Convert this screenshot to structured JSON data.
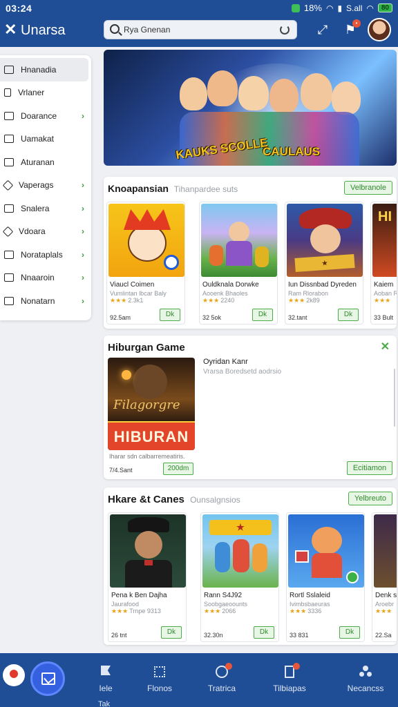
{
  "status_bar": {
    "time": "03:24",
    "indicators": "18%",
    "signal": "S.all",
    "battery_label": "80"
  },
  "app": {
    "title": "Unarsa",
    "search_value": "Rya Gnenan"
  },
  "sidebar": {
    "items": [
      {
        "label": "Hnanadia",
        "icon": "home-icon",
        "chevron": false,
        "active": true
      },
      {
        "label": "Vrlaner",
        "icon": "bookmark-icon",
        "chevron": false
      },
      {
        "label": "Doarance",
        "icon": "bag-icon",
        "chevron": true
      },
      {
        "label": "Uamakat",
        "icon": "cart-icon",
        "chevron": false
      },
      {
        "label": "Aturanan",
        "icon": "lock-icon",
        "chevron": false
      },
      {
        "label": "Vaperags",
        "icon": "puzzle-icon",
        "chevron": true
      },
      {
        "label": "Snalera",
        "icon": "frame-icon",
        "chevron": true
      },
      {
        "label": "Vdoara",
        "icon": "tools-icon",
        "chevron": true
      },
      {
        "label": "Norataplals",
        "icon": "window-icon",
        "chevron": true
      },
      {
        "label": "Nnaaroin",
        "icon": "calendar-icon",
        "chevron": true
      },
      {
        "label": "Nonatarn",
        "icon": "chat-icon",
        "chevron": true
      }
    ]
  },
  "banner": {
    "left_text": "KAUKS SCOLLE",
    "right_text": "CAULAUS"
  },
  "section1": {
    "title": "Knoapansian",
    "subtitle": "Tihanpardee suts",
    "action_label": "Velbranole",
    "cards": [
      {
        "title": "Viaucl Coimen",
        "sub": "Vumlintan lbcar Baly",
        "stars": "★★★",
        "rating": "2.3k1",
        "size": "92.5am",
        "button": "Dk",
        "art": "jester"
      },
      {
        "title": "Ouldknala Dorwke",
        "sub": "Aooenk Bhaoles",
        "stars": "★★★",
        "rating": "2240",
        "size": "32 5ok",
        "button": "Dk",
        "art": "fairy"
      },
      {
        "title": "Iun Dissnbad Dyreden",
        "sub": "Ram Rlorabon",
        "stars": "★★★",
        "rating": "2k89",
        "size": "32.tant",
        "button": "Dk",
        "art": "pirate"
      },
      {
        "title": "Kaiem",
        "sub": "Aoban R",
        "stars": "★★★",
        "rating": "",
        "size": "33 Bult",
        "button": "",
        "art": "hi"
      }
    ]
  },
  "section2": {
    "title": "Hiburgan Game",
    "feature_title": "Oyridan Kanr",
    "feature_sub": "Vrarsa Boredsetd aodrsio",
    "thumb_caption": "Filagorgre",
    "logo_text": "HIBURAN",
    "desc": "Iharar sdn calbarremeatiris.",
    "size": "7/4.Sant",
    "price": "200dm",
    "action_label": "Ecitiamon"
  },
  "section3": {
    "title": "Hkare &t Canes",
    "subtitle": "Ounsalgnsios",
    "action_label": "Yelbreuto",
    "cards": [
      {
        "title": "Pena k Ben Dajha",
        "sub": "Jaurafood",
        "stars": "★★★",
        "rating": "Trnpe 9313",
        "size": "26 tnt",
        "button": "Dk",
        "art": "magician"
      },
      {
        "title": "Rann S4J92",
        "sub": "Soobgaeoounts",
        "stars": "★★★",
        "rating": "2066",
        "size": "32.30n",
        "button": "Dk",
        "art": "boredasn"
      },
      {
        "title": "Rortl Sslaleid",
        "sub": "Ivimbsbaeuras",
        "stars": "★★★",
        "rating": "3336",
        "size": "33 831",
        "button": "Dk",
        "art": "dino"
      },
      {
        "title": "Denk s",
        "sub": "Aroebr",
        "stars": "★★★",
        "rating": "",
        "size": "22.Sa",
        "button": "",
        "art": "dark"
      }
    ]
  },
  "bottom_nav": {
    "items": [
      {
        "label": "Iele",
        "icon": "flag-icon"
      },
      {
        "label": "Flonos",
        "icon": "grid-icon"
      },
      {
        "label": "Tratrica",
        "icon": "game-icon"
      },
      {
        "label": "Tilbiapas",
        "icon": "bookmark-icon"
      },
      {
        "label": "Necancss",
        "icon": "people-icon"
      }
    ],
    "extra_label": "Tak"
  },
  "colors": {
    "primary": "#1f4e96",
    "accent_green": "#4bab47",
    "fab": "#3560e0"
  }
}
